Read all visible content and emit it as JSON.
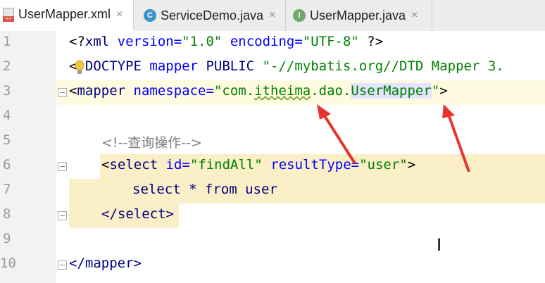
{
  "tabs": [
    {
      "label": "UserMapper.xml",
      "icon": "xml-file-icon",
      "active": true
    },
    {
      "label": "ServiceDemo.java",
      "icon": "java-class-icon",
      "active": false
    },
    {
      "label": "UserMapper.java",
      "icon": "java-interface-icon",
      "active": false
    }
  ],
  "close_glyph": "×",
  "lines": {
    "n1": "1",
    "n2": "2",
    "n3": "3",
    "n4": "4",
    "n5": "5",
    "n6": "6",
    "n7": "7",
    "n8": "8",
    "n9": "9",
    "n10": "10"
  },
  "code": {
    "l1_open": "<?",
    "l1_tag": "xml",
    "l1_attr1": " version=",
    "l1_val1": "\"1.0\"",
    "l1_attr2": " encoding=",
    "l1_val2": "\"UTF-8\"",
    "l1_close": " ?>",
    "l2_open": "<!",
    "l2_doctype": "DOCTYPE",
    "l2_rest1": " mapper",
    "l2_public": " PUBLIC",
    "l2_val": " \"-//mybatis.org//DTD Mapper 3.",
    "l3_open": "<",
    "l3_tag": "mapper",
    "l3_attr": " namespace=",
    "l3_q1": "\"com.",
    "l3_pkg": "itheima",
    "l3_mid": ".dao.",
    "l3_cls": "UserMapper",
    "l3_q2": "\"",
    "l3_close": ">",
    "l5_comment": "<!--查询操作-->",
    "l6_open": "<",
    "l6_tag": "select",
    "l6_attr1": " id=",
    "l6_val1": "\"findAll\"",
    "l6_attr2": " resultType=",
    "l6_val2": "\"user\"",
    "l6_close": ">",
    "l7_select": "select",
    "l7_rest": " * from user",
    "l8_close": "</select>",
    "l10_close": "</mapper>"
  },
  "colors": {
    "annotation_arrow": "#e8352b",
    "tag": "#000080",
    "attribute": "#0000ff",
    "value": "#008000",
    "block_highlight": "#fbefc7"
  }
}
